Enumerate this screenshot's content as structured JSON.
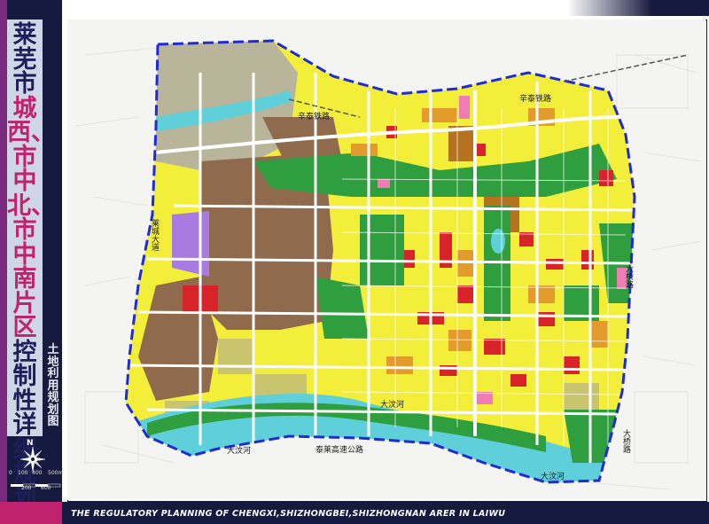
{
  "title": {
    "part1": "莱芜市",
    "part2": "城西、市中北、市中南片区",
    "part3": "控制性详细规划"
  },
  "subtitle": "土地利用规划图",
  "north_label": "N",
  "scale": {
    "ticks": [
      "0",
      "100",
      "400",
      "500m"
    ],
    "ticks2": [
      "200",
      "600"
    ]
  },
  "english_title": "THE REGULATORY PLANNING OF CHENGXI,SHIZHONGBEI,SHIZHONGNAN ARER IN LAIWU",
  "map_labels": {
    "rail_west": "辛泰铁路",
    "rail_east": "辛泰铁路",
    "laicheng_road": "莱城大道",
    "daqiao_road_upper": "大桥路",
    "daqiao_road_lower": "大桥路",
    "river_center": "大汶河",
    "river_west": "大汶河",
    "river_east": "大汶河",
    "expressway": "泰莱高速公路"
  },
  "colors": {
    "banner": "#161a3e",
    "accent_pink": "#c0226f",
    "residential": "#f2ee3a",
    "commercial": "#d8232a",
    "industrial": "#8f6a4d",
    "green": "#2f9e3f",
    "water": "#5fd0d9",
    "boundary": "#1f2ccf",
    "admin": "#f07cb6",
    "warehouse": "#a97be0"
  }
}
